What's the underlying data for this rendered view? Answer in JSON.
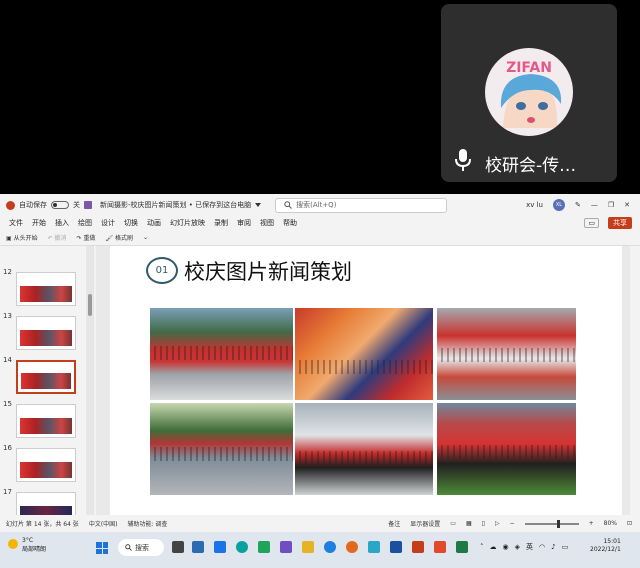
{
  "call_tile": {
    "avatar_logo_text": "ZIFAN",
    "participant_name": "校研会-传…"
  },
  "window": {
    "autosave_label": "自动保存",
    "autosave_state": "关",
    "title": "新闻摄影-校庆图片新闻策划 • 已保存到这台电脑",
    "search_placeholder": "搜索(Alt+Q)",
    "user_name": "xv lu",
    "user_initials": "XL"
  },
  "menu": {
    "items": [
      "文件",
      "开始",
      "插入",
      "绘图",
      "设计",
      "切换",
      "动画",
      "幻灯片放映",
      "录制",
      "审阅",
      "视图",
      "帮助"
    ],
    "share_label": "共享"
  },
  "ribbon": {
    "from_start": "从头开始",
    "undo": "撤消",
    "redo": "重做",
    "format_painter": "格式刷"
  },
  "thumbnails": [
    {
      "num": "12"
    },
    {
      "num": "13"
    },
    {
      "num": "14"
    },
    {
      "num": "15"
    },
    {
      "num": "16"
    },
    {
      "num": "17"
    }
  ],
  "slide": {
    "number": "01",
    "title": "校庆图片新闻策划"
  },
  "status": {
    "slide_pos": "幻灯片 第 14 张，共 64 张",
    "language": "中文(中国)",
    "accessibility": "辅助功能: 调查",
    "notes": "备注",
    "display_settings": "显示器设置",
    "zoom": "80%"
  },
  "taskbar": {
    "weather_temp": "3°C",
    "weather_desc": "局部晴朗",
    "search_label": "搜索",
    "ime": "英",
    "time": "15:01",
    "date": "2022/12/1"
  }
}
